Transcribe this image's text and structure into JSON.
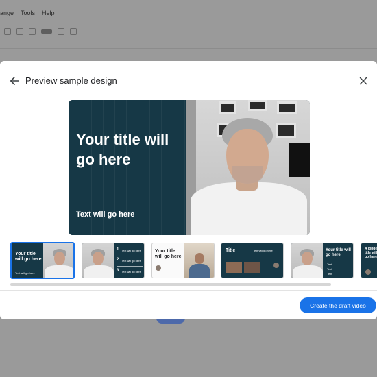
{
  "background_app": {
    "menu": [
      "ange",
      "Tools",
      "Help"
    ]
  },
  "dialog": {
    "title": "Preview sample design",
    "back_icon": "arrow-left-icon",
    "close_icon": "close-icon"
  },
  "preview": {
    "title": "Your title will go here",
    "text": "Text will go here"
  },
  "thumbnails": [
    {
      "title": "Your title will go here",
      "subtitle": "Text will go here",
      "selected": true
    },
    {
      "items": [
        {
          "num": "1",
          "text": "Text will go here"
        },
        {
          "num": "2",
          "text": "Text will go here"
        },
        {
          "num": "3",
          "text": "Text will go here"
        }
      ]
    },
    {
      "title": "Your title will go here"
    },
    {
      "title": "Title",
      "subtitle": "Text will go here"
    },
    {
      "title": "Your title will go here",
      "bullets": [
        "Text",
        "Text",
        "Text"
      ]
    },
    {
      "title": "A longer title will go here"
    }
  ],
  "footer": {
    "create_label": "Create the draft video"
  },
  "colors": {
    "accent": "#1a73e8",
    "slide_dark": "#163846"
  }
}
